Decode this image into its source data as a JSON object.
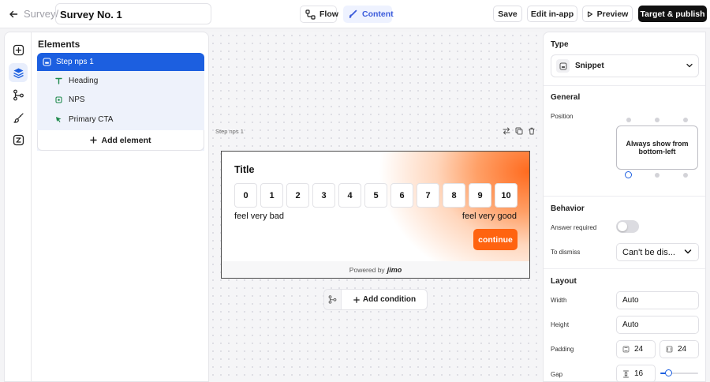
{
  "header": {
    "breadcrumb": "Survey/",
    "survey_name": "Survey No. 1",
    "view_tabs": [
      {
        "label": "Flow",
        "active": false
      },
      {
        "label": "Content",
        "active": true
      }
    ],
    "actions": {
      "save": "Save",
      "edit_in_app": "Edit in-app",
      "preview": "Preview",
      "publish": "Target & publish"
    }
  },
  "rail": {
    "icons": [
      "plus-square-icon",
      "layers-icon",
      "branch-icon",
      "brush-icon",
      "formula-icon"
    ],
    "active": "layers-icon"
  },
  "elements_panel": {
    "title": "Elements",
    "step": "Step nps 1",
    "children": [
      {
        "label": "Heading",
        "icon": "text-icon"
      },
      {
        "label": "NPS",
        "icon": "nps-icon"
      },
      {
        "label": "Primary CTA",
        "icon": "cursor-icon"
      }
    ],
    "add_element": "Add element"
  },
  "canvas": {
    "step_label": "Step nps 1",
    "snippet": {
      "title": "Title",
      "scale": [
        "0",
        "1",
        "2",
        "3",
        "4",
        "5",
        "6",
        "7",
        "8",
        "9",
        "10"
      ],
      "low_label": "feel very bad",
      "high_label": "feel very good",
      "cta": "continue",
      "powered_by": "Powered by",
      "brand": "jimo"
    },
    "add_condition": "Add condition"
  },
  "properties": {
    "type": {
      "title": "Type",
      "value": "Snippet"
    },
    "general": {
      "title": "General",
      "position_label": "Position",
      "position_value": "Always show from bottom-left"
    },
    "behavior": {
      "title": "Behavior",
      "answer_required_label": "Answer required",
      "answer_required": false,
      "to_dismiss_label": "To dismiss",
      "to_dismiss_value": "Can't be dis..."
    },
    "layout": {
      "title": "Layout",
      "width_label": "Width",
      "width_value": "Auto",
      "height_label": "Height",
      "height_value": "Auto",
      "padding_label": "Padding",
      "padding_vertical": "24",
      "padding_horizontal": "24",
      "gap_label": "Gap",
      "gap_value": "16",
      "gap_slider_level": 0.2
    }
  },
  "colors": {
    "accent_blue": "#1c5fe0",
    "cta_orange": "#ff6310",
    "publish_bg": "#111111"
  }
}
